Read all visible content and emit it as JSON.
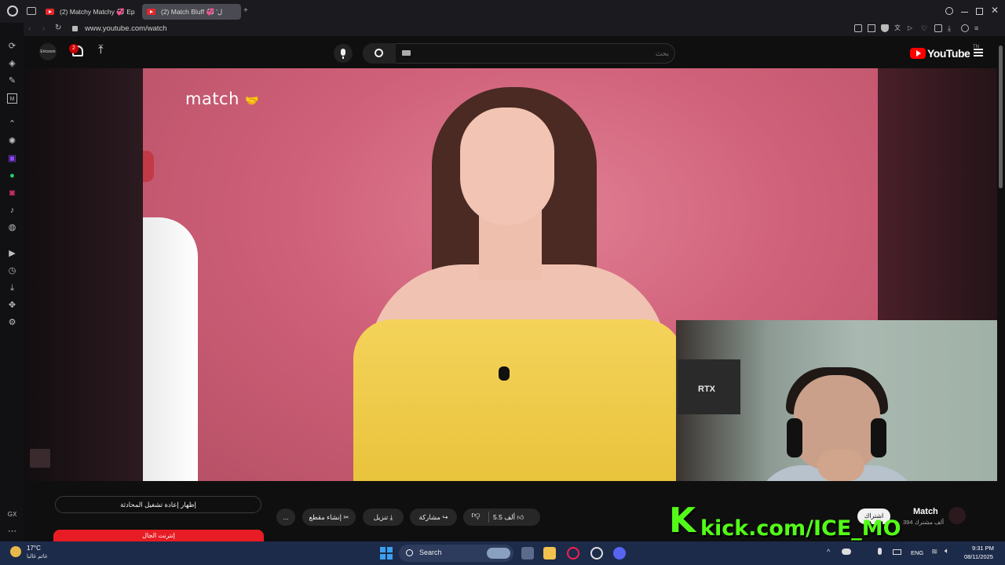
{
  "browser": {
    "tabs": [
      {
        "label": "(2) Matchy Matchy 💞 Ep"
      },
      {
        "label": "(2) Match Bluff 💞 'ل"
      }
    ],
    "url": "www.youtube.com/watch"
  },
  "youtube": {
    "logo_text": "YouTube",
    "logo_region": "TN",
    "notification_count": "2",
    "search_placeholder": "بحث",
    "avatar_label": "Ericsson"
  },
  "video": {
    "brand_overlay": "match"
  },
  "actions": {
    "like_count": "5.5 ألف",
    "share_label": "مشاركة",
    "download_label": "تنزيل",
    "clip_label": "إنشاء مقطع",
    "more_label": "...",
    "replay_chat": "إظهار إعادة تشغيل المحادثة",
    "ad_banner": "إنترنت الجال"
  },
  "channel": {
    "name": "Match",
    "subscribers": "394 ألف مشترك",
    "subscribe_label": "اشتراك"
  },
  "stream_overlay": {
    "kick_letter": "K",
    "kick_url": "kick.com/ICE_MO",
    "rtx": "RTX"
  },
  "taskbar": {
    "weather_temp": "17°C",
    "weather_desc": "غائم غالبا",
    "search_label": "Search",
    "lang": "ENG",
    "time": "9:31 PM",
    "date": "08/11/2025"
  },
  "colors": {
    "accent_red": "#ff0000",
    "kick_green": "#53fc18",
    "taskbar": "#1d2b4a"
  }
}
